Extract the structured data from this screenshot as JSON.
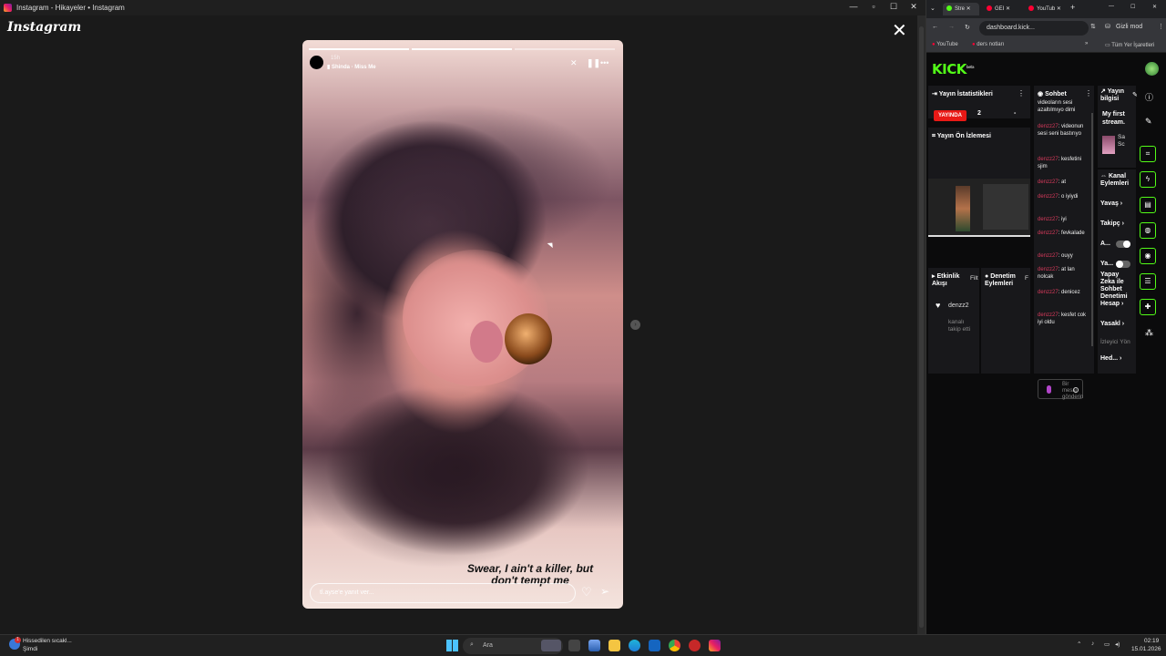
{
  "instagram_window": {
    "title": "Instagram - Hikayeler • Instagram",
    "logo": "Instagram",
    "story": {
      "time": "15h",
      "music": "Shinda · Miss Me",
      "caption": "Swear, I ain't a killer, but don't tempt me",
      "reply_placeholder": "tl.ayse'e yanıt ver...",
      "icons": [
        "mute-icon",
        "pause-icon",
        "more-icon",
        "heart-icon",
        "send-icon"
      ]
    }
  },
  "chrome": {
    "tabs": [
      {
        "label": "Stre",
        "color": "#53fc18"
      },
      {
        "label": "GEI",
        "color": "#ff0033"
      },
      {
        "label": "YouTub",
        "color": "#ff0033"
      }
    ],
    "address": "dashboard.kick...",
    "incognito": "Gizli mod",
    "bookmarks": [
      "YouTube",
      "ders notları"
    ],
    "all_bookmarks": "Tüm Yer İşaretleri"
  },
  "kick": {
    "logo": "KICK",
    "logo_sup": "beta",
    "stats": {
      "title": "Yayın İstatistikleri",
      "live": "YAYINDA",
      "viewers": "2",
      "dash": "-"
    },
    "preview_title": "Yayın Ön İzlemesi",
    "activity": {
      "title": "Etkinlik Akışı",
      "filter": "Filt",
      "user": "denzz2",
      "event": "kanalı takip etti"
    },
    "moderation": {
      "title": "Denetim Eylemleri",
      "filter": "F"
    },
    "chat": {
      "title": "Sohbet",
      "top_text": "videoların sesi azaltılmıyo dimi",
      "messages": [
        {
          "user": "denzz27",
          "text": "videonun sesi seni bastırıyo"
        },
        {
          "user": "denzz27",
          "text": "kesfetini sjim"
        },
        {
          "user": "denzz27",
          "text": "at"
        },
        {
          "user": "denzz27",
          "text": "o iyiydi"
        },
        {
          "user": "denzz27",
          "text": "iyi"
        },
        {
          "user": "denzz27",
          "text": "fevkalade"
        },
        {
          "user": "denzz27",
          "text": "ouyy"
        },
        {
          "user": "denzz27",
          "text": "at lan nolcak"
        },
        {
          "user": "denzz27",
          "text": "denicez"
        },
        {
          "user": "denzz27",
          "text": "kesfet cok iyi oldu"
        }
      ],
      "input_placeholder": "Bir mesaj gönderin"
    },
    "stream_info": {
      "title": "Yayın bilgisi",
      "stream_title": "My first stream.",
      "cat1": "Sa",
      "cat2": "Sc"
    },
    "channel_actions": {
      "title": "Kanal Eylemleri",
      "items": [
        "Yavaş",
        "Takipç",
        "A...",
        "Ya...",
        "Yapay Zeka ile Sohbet Denetimi",
        "Hesap",
        "Yasakl",
        "İzleyici Yön",
        "Hed..."
      ]
    }
  },
  "taskbar": {
    "weather_line1": "Hissedilen sıcakl...",
    "weather_line2": "Şimdi",
    "weather_badge": "1",
    "search": "Ara",
    "time": "02:19",
    "date": "15.01.2026"
  }
}
